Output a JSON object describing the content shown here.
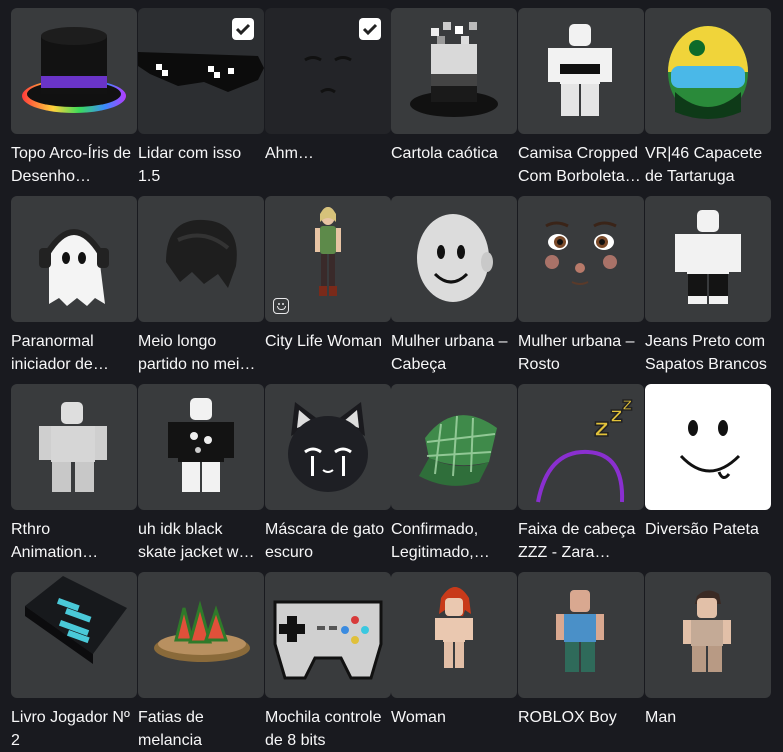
{
  "items": [
    {
      "name": "Topo Arco-Íris de Desenho…",
      "selected": false,
      "icon": "rainbow-top-hat-icon"
    },
    {
      "name": "Lidar com isso 1.5",
      "selected": true,
      "icon": "pixel-sunglasses-icon"
    },
    {
      "name": "Ahm…",
      "selected": true,
      "icon": "dark-face-icon"
    },
    {
      "name": "Cartola caótica",
      "selected": false,
      "icon": "chaotic-top-hat-icon"
    },
    {
      "name": "Camisa Cropped Com Borboleta…",
      "selected": false,
      "icon": "cropped-shirt-avatar-icon"
    },
    {
      "name": "VR|46 Capacete de Tartaruga",
      "selected": false,
      "icon": "turtle-helmet-icon"
    },
    {
      "name": "Paranormal iniciador de…",
      "selected": false,
      "icon": "ghost-headphones-icon"
    },
    {
      "name": "Meio longo partido no mei…",
      "selected": false,
      "icon": "black-hair-icon"
    },
    {
      "name": "City Life Woman",
      "selected": false,
      "icon": "city-woman-avatar-icon",
      "badge": "emote-icon"
    },
    {
      "name": "Mulher urbana – Cabeça",
      "selected": false,
      "icon": "urban-head-icon"
    },
    {
      "name": "Mulher urbana – Rosto",
      "selected": false,
      "icon": "urban-face-icon"
    },
    {
      "name": "Jeans Preto com Sapatos Brancos",
      "selected": false,
      "icon": "black-jeans-avatar-icon"
    },
    {
      "name": "Rthro Animation…",
      "selected": false,
      "icon": "rthro-animation-icon"
    },
    {
      "name": "uh idk black skate jacket w…",
      "selected": false,
      "icon": "skate-jacket-avatar-icon"
    },
    {
      "name": "Máscara de gato escuro",
      "selected": false,
      "icon": "cat-mask-icon"
    },
    {
      "name": "Confirmado, Legitimado,…",
      "selected": false,
      "icon": "green-plaid-cap-icon"
    },
    {
      "name": "Faixa de cabeça ZZZ - Zara…",
      "selected": false,
      "icon": "zzz-headband-icon"
    },
    {
      "name": "Diversão Pateta",
      "selected": false,
      "icon": "goofy-face-icon"
    },
    {
      "name": "Livro Jogador Nº 2",
      "selected": false,
      "icon": "player-book-icon"
    },
    {
      "name": "Fatias de melancia",
      "selected": false,
      "icon": "watermelon-slices-icon"
    },
    {
      "name": "Mochila controle de 8 bits",
      "selected": false,
      "icon": "controller-backpack-icon"
    },
    {
      "name": "Woman",
      "selected": false,
      "icon": "woman-avatar-icon"
    },
    {
      "name": "ROBLOX Boy",
      "selected": false,
      "icon": "roblox-boy-avatar-icon"
    },
    {
      "name": "Man",
      "selected": false,
      "icon": "man-avatar-icon"
    }
  ]
}
